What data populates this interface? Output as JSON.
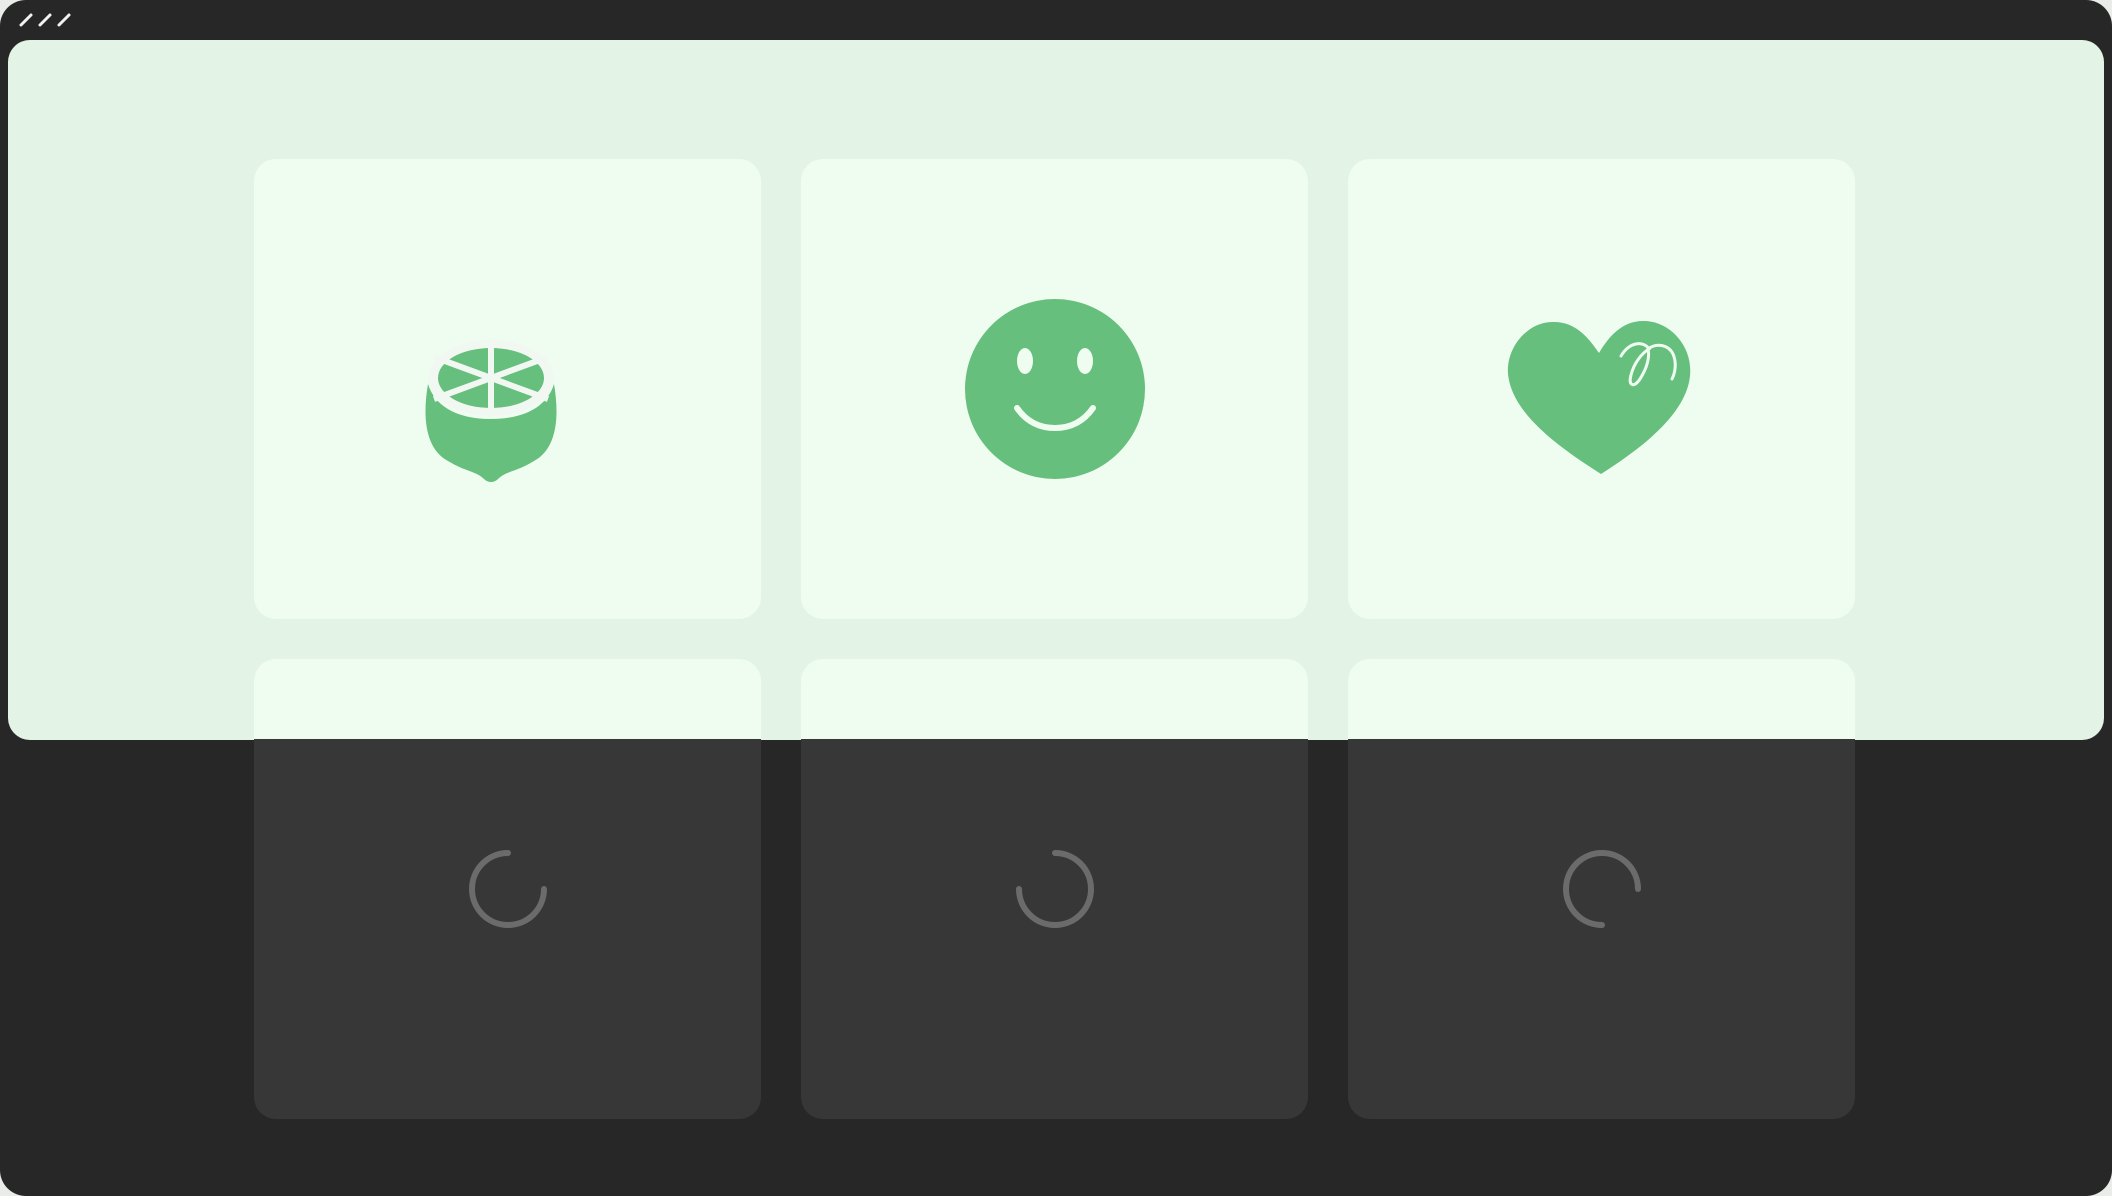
{
  "window": {
    "titlebar_icons": [
      "resize-icon",
      "resize-icon",
      "resize-icon"
    ]
  },
  "colors": {
    "frame": "#272727",
    "panel": "#e3f3e6",
    "card_light": "#effdf1",
    "card_dark": "#373737",
    "accent_green": "#66bf7d",
    "spinner": "#6b6b6b"
  },
  "grid": {
    "row1": [
      {
        "icon": "lime-slice-icon",
        "state": "loaded"
      },
      {
        "icon": "smiley-face-icon",
        "state": "loaded"
      },
      {
        "icon": "heart-icon",
        "state": "loaded"
      }
    ],
    "row2": [
      {
        "icon": "loading-spinner-icon",
        "state": "loading"
      },
      {
        "icon": "loading-spinner-icon",
        "state": "loading"
      },
      {
        "icon": "loading-spinner-icon",
        "state": "loading"
      }
    ]
  }
}
